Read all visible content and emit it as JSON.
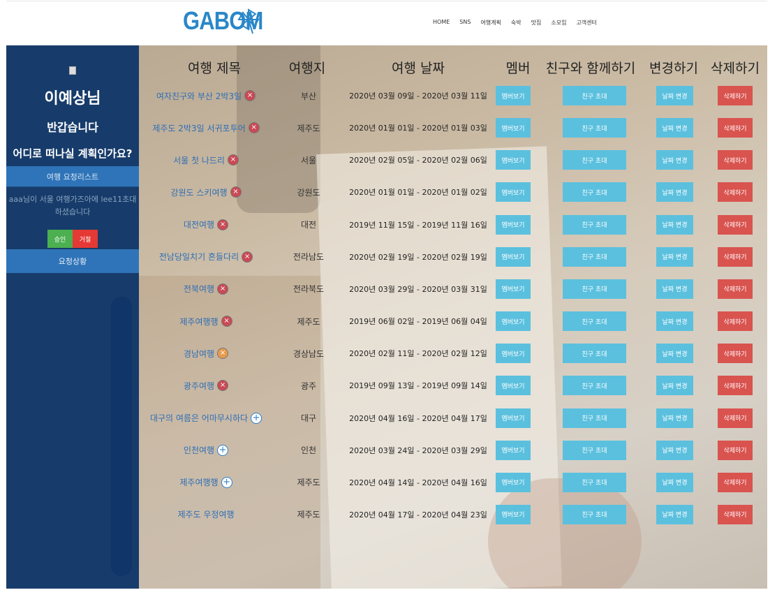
{
  "header": {
    "logo_text": "GABOM",
    "nav": [
      "HOME",
      "SNS",
      "여행계획",
      "숙박",
      "맛집",
      "소모임",
      "고객센터"
    ]
  },
  "sidebar": {
    "user_name": "이예상님",
    "greeting": "반갑습니다",
    "question": "어디로 떠나실 계획인가요?",
    "request_list_label": "여행 요청리스트",
    "request_message": "aaa님이 서울 여행가즈아에 lee11초대하셨습니다",
    "approve_label": "승인",
    "reject_label": "거절",
    "status_label": "요청상황"
  },
  "table": {
    "headers": {
      "title": "여행 제목",
      "place": "여행지",
      "date": "여행 날짜",
      "member": "멤버",
      "invite": "친구와 함께하기",
      "change": "변경하기",
      "delete": "삭제하기"
    },
    "buttons": {
      "member": "멤버보기",
      "invite": "친구 초대",
      "change": "날짜 변경",
      "delete": "삭제하기"
    },
    "rows": [
      {
        "title": "여자친구와 부산 2박3일",
        "icon": "delete-icon",
        "place": "부산",
        "date": "2020년 03월 09일 - 2020년 03월 11일"
      },
      {
        "title": "제주도 2박3일 서귀포투어",
        "icon": "delete-icon",
        "place": "제주도",
        "date": "2020년 01월 01일 - 2020년 01월 03일"
      },
      {
        "title": "서울 첫 나드리",
        "icon": "delete-icon",
        "place": "서울",
        "date": "2020년 02월 05일 - 2020년 02월 06일"
      },
      {
        "title": "강원도 스키여행",
        "icon": "delete-icon",
        "place": "강원도",
        "date": "2020년 01월 01일 - 2020년 01월 02일"
      },
      {
        "title": "대전여행",
        "icon": "delete-icon",
        "place": "대전",
        "date": "2019년 11월 15일 - 2019년 11월 16일"
      },
      {
        "title": "전남당일치기 흔들다리",
        "icon": "delete-icon",
        "place": "전라남도",
        "date": "2020년 02월 19일 - 2020년 02월 19일"
      },
      {
        "title": "전북여행",
        "icon": "delete-icon",
        "place": "전라북도",
        "date": "2020년 03월 29일 - 2020년 03월 31일"
      },
      {
        "title": "제주여행행",
        "icon": "delete-icon",
        "place": "제주도",
        "date": "2019년 06월 02일 - 2019년 06월 04일"
      },
      {
        "title": "경남여행",
        "icon": "delete-orange-icon",
        "place": "경상남도",
        "date": "2020년 02월 11일 - 2020년 02월 12일"
      },
      {
        "title": "광주여행",
        "icon": "delete-icon",
        "place": "광주",
        "date": "2019년 09월 13일 - 2019년 09월 14일"
      },
      {
        "title": "대구의 여름은 어마무시하다",
        "icon": "add-icon",
        "place": "대구",
        "date": "2020년 04월 16일 - 2020년 04월 17일"
      },
      {
        "title": "인천여행",
        "icon": "add-icon",
        "place": "인천",
        "date": "2020년 03월 24일 - 2020년 03월 29일"
      },
      {
        "title": "제주여행행",
        "icon": "add-icon",
        "place": "제주도",
        "date": "2020년 04월 14일 - 2020년 04월 16일"
      },
      {
        "title": "제주도 우정여행",
        "icon": "none",
        "place": "제주도",
        "date": "2020년 04월 17일 - 2020년 04월 23일"
      }
    ]
  },
  "colors": {
    "brand": "#2a87c8",
    "sidebar": "#173c6b",
    "info_button": "#5bc0de",
    "danger_button": "#d9534f",
    "approve": "#4caf50",
    "reject": "#e53935"
  }
}
